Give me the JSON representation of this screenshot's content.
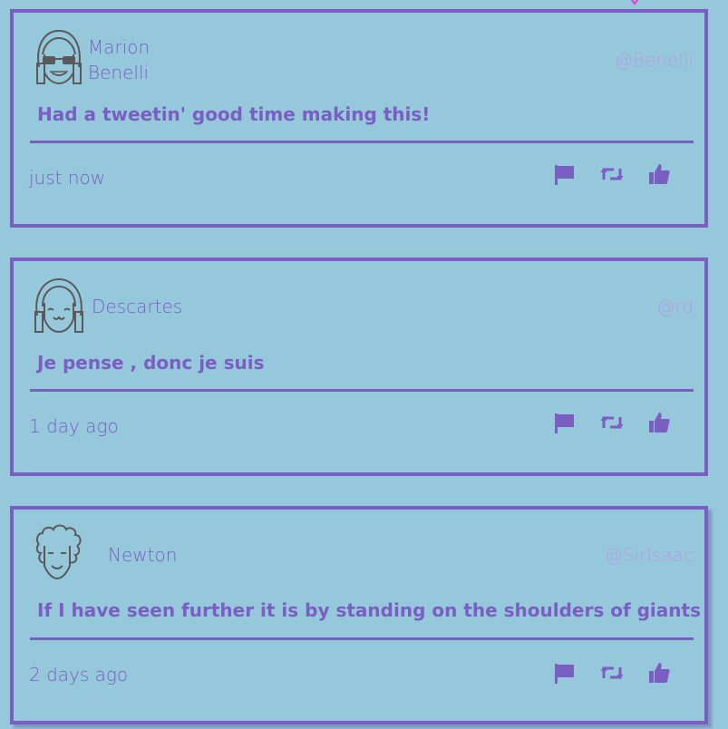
{
  "colors": {
    "background": "#96c8dc",
    "accent": "#7a5ec2",
    "handle": "#b59ce3"
  },
  "tweets": [
    {
      "name": "Marion Benelli",
      "handle": "@Benelli",
      "message": "Had a tweetin' good time making this!",
      "timestamp": "just now",
      "avatar_icon": "avatar-sunglasses-icon"
    },
    {
      "name": "Descartes",
      "handle": "@rd",
      "message": "Je pense , donc je suis",
      "timestamp": "1 day ago",
      "avatar_icon": "avatar-smiling-icon"
    },
    {
      "name": "Newton",
      "handle": "@SirIsaac",
      "message": "If I have seen further it is by standing on the shoulders of giants",
      "timestamp": "2 days ago",
      "avatar_icon": "avatar-curly-hair-icon"
    }
  ],
  "actions": [
    "flag-icon",
    "retweet-icon",
    "like-icon"
  ]
}
